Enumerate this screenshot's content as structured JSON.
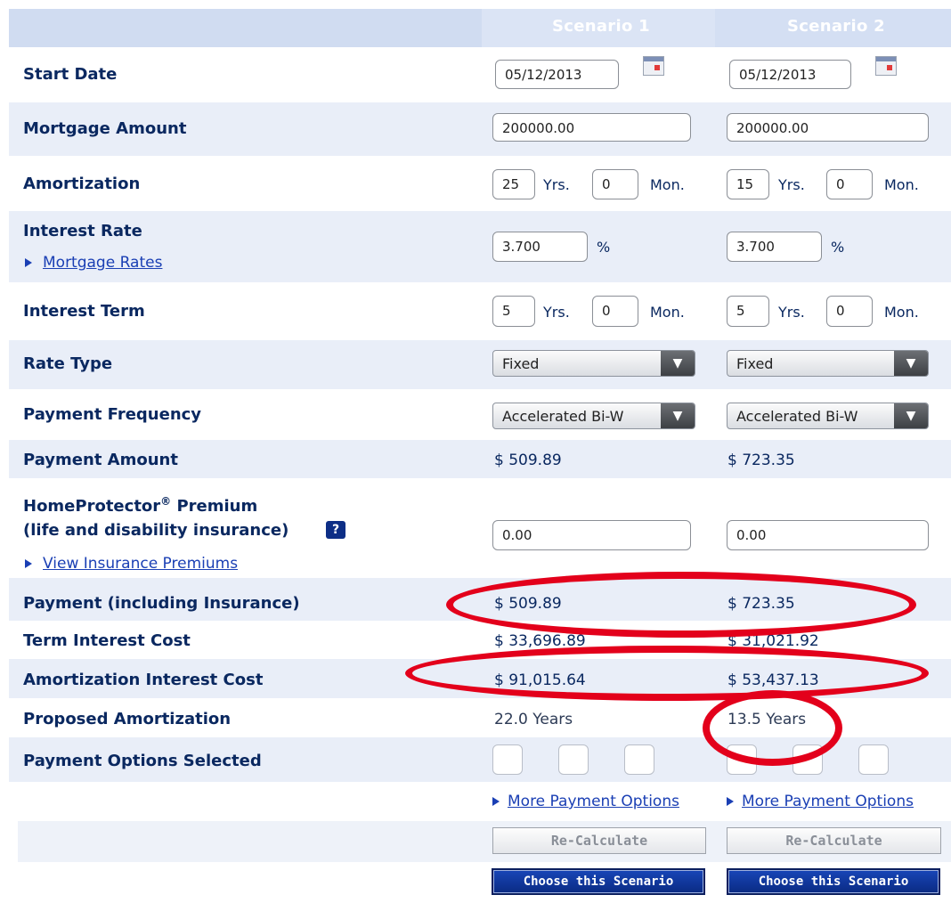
{
  "header": {
    "scenario1": "Scenario 1",
    "scenario2": "Scenario 2"
  },
  "rows": {
    "start_date": {
      "label": "Start Date",
      "s1": "05/12/2013",
      "s2": "05/12/2013",
      "icon": "calendar-icon"
    },
    "mortgage_amount": {
      "label": "Mortgage Amount",
      "s1": "200000.00",
      "s2": "200000.00"
    },
    "amortization": {
      "label": "Amortization",
      "s1_years": "25",
      "s1_months": "0",
      "s2_years": "15",
      "s2_months": "0",
      "yrs_unit": "Yrs.",
      "mon_unit": "Mon."
    },
    "interest_rate": {
      "label": "Interest Rate",
      "s1": "3.700",
      "s2": "3.700",
      "unit": "%",
      "link": "Mortgage Rates"
    },
    "interest_term": {
      "label": "Interest Term",
      "s1_years": "5",
      "s1_months": "0",
      "s2_years": "5",
      "s2_months": "0",
      "yrs_unit": "Yrs.",
      "mon_unit": "Mon."
    },
    "rate_type": {
      "label": "Rate Type",
      "s1": "Fixed",
      "s2": "Fixed"
    },
    "payment_frequency": {
      "label": "Payment Frequency",
      "s1": "Accelerated Bi-W",
      "s2": "Accelerated Bi-W"
    },
    "payment_amount": {
      "label": "Payment Amount",
      "s1": "$ 509.89",
      "s2": "$ 723.35"
    },
    "home_protector": {
      "label_line1": "HomeProtector",
      "reg": "®",
      "label_line1_suffix": " Premium",
      "label_line2": "(life and disability insurance)",
      "help": "?",
      "link": "View Insurance Premiums",
      "s1": "0.00",
      "s2": "0.00"
    },
    "payment_incl_insurance": {
      "label": "Payment (including Insurance)",
      "s1": "$ 509.89",
      "s2": "$ 723.35"
    },
    "term_interest_cost": {
      "label": "Term Interest Cost",
      "s1": "$ 33,696.89",
      "s2": "$ 31,021.92"
    },
    "amortization_interest_cost": {
      "label": "Amortization Interest Cost",
      "s1": "$ 91,015.64",
      "s2": "$ 53,437.13"
    },
    "proposed_amortization": {
      "label": "Proposed Amortization",
      "s1": "22.0 Years",
      "s2": "13.5 Years"
    },
    "payment_options_selected": {
      "label": "Payment Options Selected"
    }
  },
  "footer": {
    "more_options_s1": "More Payment Options",
    "more_options_s2": "More Payment Options",
    "recalculate_s1": "Re-Calculate",
    "recalculate_s2": "Re-Calculate",
    "choose_s1": "Choose this Scenario",
    "choose_s2": "Choose this Scenario"
  },
  "colors": {
    "label_navy": "#0a2860",
    "link_blue": "#1a3fb4",
    "annotation_red": "#e3001b",
    "header_band": "#d0dcf1",
    "row_shade": "#e9eef8"
  }
}
